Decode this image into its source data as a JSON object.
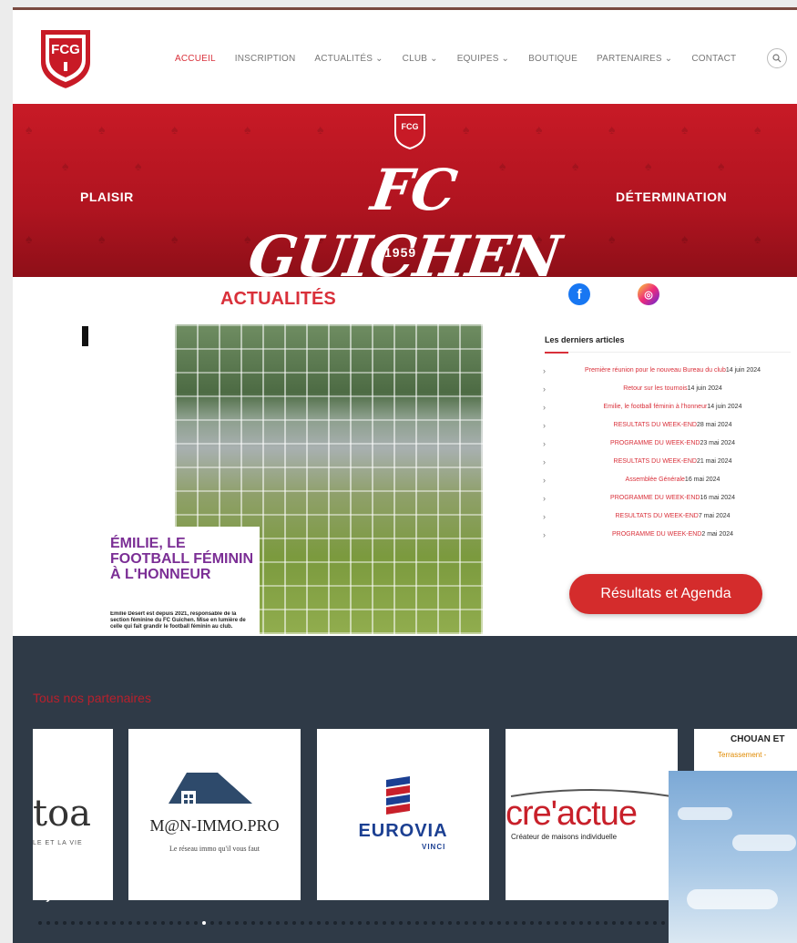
{
  "nav": {
    "items": [
      "ACCUEIL",
      "INSCRIPTION",
      "ACTUALITÉS ⌄",
      "CLUB ⌄",
      "EQUIPES ⌄",
      "BOUTIQUE",
      "PARTENAIRES ⌄",
      "CONTACT"
    ],
    "active_index": 0
  },
  "logo": {
    "text": "FCG"
  },
  "banner": {
    "title": "FC GUICHEN",
    "left_word": "PLAISIR",
    "right_word": "DÉTERMINATION",
    "year": "1959"
  },
  "news": {
    "title": "ACTUALITÉS",
    "card_headline": "ÉMILIE, LE FOOTBALL FÉMININ À L'HONNEUR",
    "card_body": "Émilie Désert est depuis 2021, responsable de la section féminine du FC Guichen. Mise en lumière de celle qui fait grandir le football féminin au club."
  },
  "recent": {
    "heading": "Les derniers articles",
    "articles": [
      {
        "title": "Première réunion pour le nouveau Bureau du club",
        "date": "14 juin 2024"
      },
      {
        "title": "Retour sur les tournois",
        "date": "14 juin 2024"
      },
      {
        "title": "Emilie, le football féminin à l'honneur",
        "date": "14 juin 2024"
      },
      {
        "title": "RESULTATS DU WEEK-END",
        "date": "28 mai 2024"
      },
      {
        "title": "PROGRAMME DU WEEK-END",
        "date": "23 mai 2024"
      },
      {
        "title": "RESULTATS DU WEEK-END",
        "date": "21 mai 2024"
      },
      {
        "title": "Assemblée Générale",
        "date": "16 mai 2024"
      },
      {
        "title": "PROGRAMME DU WEEK-END",
        "date": "16 mai 2024"
      },
      {
        "title": "RESULTATS DU WEEK-END",
        "date": "7 mai 2024"
      },
      {
        "title": "PROGRAMME DU WEEK-END",
        "date": "2 mai 2024"
      }
    ],
    "button": "Résultats et Agenda"
  },
  "partners": {
    "title": "Tous nos partenaires",
    "toa": "toa",
    "toa_sub": "LE ET LA VIE",
    "mn_name": "M@N-IMMO.PRO",
    "mn_sub": "Le réseau immo qu'il vous faut",
    "eurovia": "EUROVIA",
    "vinci": "VINCI",
    "creactue": "cre'actue",
    "creactue_sub": "Créateur de maisons individuelle",
    "chouan": "CHOUAN ET",
    "terras": "Terrassement -"
  },
  "colors": {
    "brand_red": "#d9303a",
    "banner_red": "#c81a26",
    "partners_bg": "#2f3a47"
  }
}
